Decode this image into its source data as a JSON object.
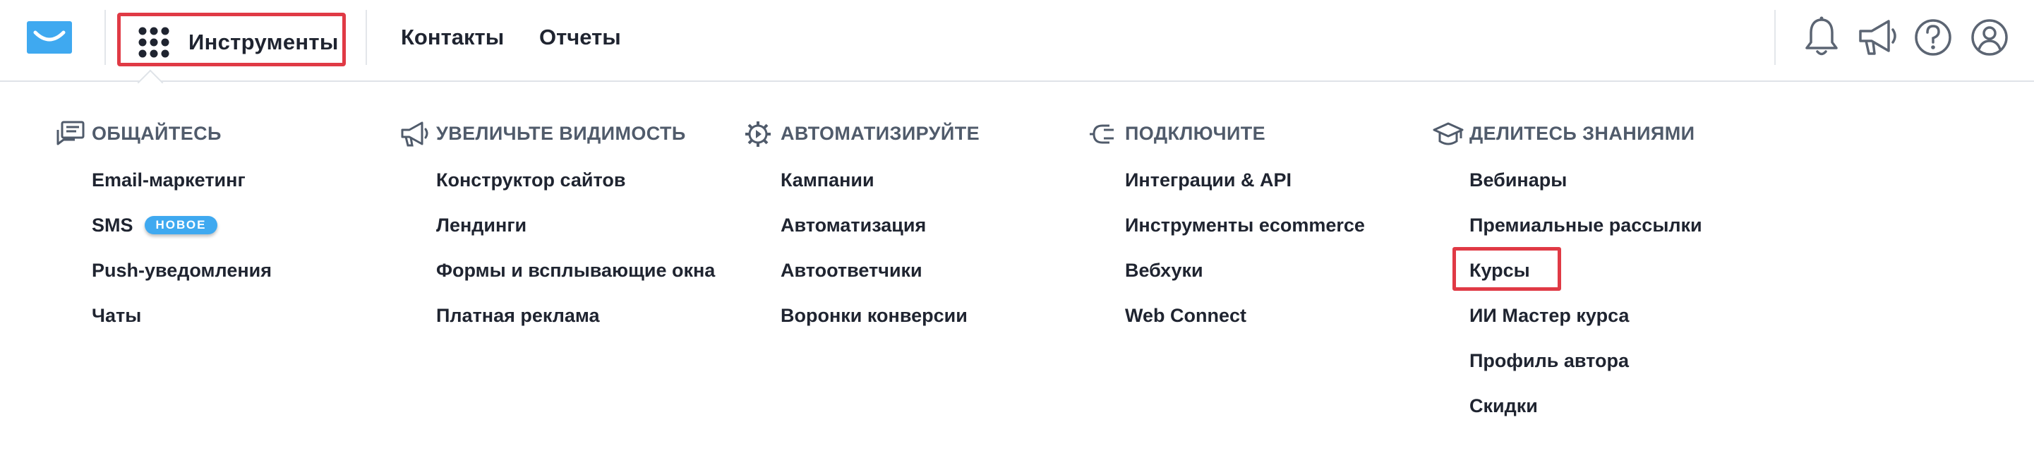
{
  "header": {
    "tools_label": "Инструменты",
    "nav": [
      "Контакты",
      "Отчеты"
    ],
    "icons": [
      "bell-icon",
      "megaphone-icon",
      "help-icon",
      "account-icon"
    ]
  },
  "menu": {
    "columns": [
      {
        "icon": "chat-icon",
        "title": "ОБЩАЙТЕСЬ",
        "items": [
          {
            "label": "Email-маркетинг"
          },
          {
            "label": "SMS",
            "badge": "НОВОЕ"
          },
          {
            "label": "Push-уведомления"
          },
          {
            "label": "Чаты"
          }
        ]
      },
      {
        "icon": "megaphone-icon",
        "title": "УВЕЛИЧЬТЕ ВИДИМОСТЬ",
        "items": [
          {
            "label": "Конструктор сайтов"
          },
          {
            "label": "Лендинги"
          },
          {
            "label": "Формы и всплывающие окна"
          },
          {
            "label": "Платная реклама"
          }
        ]
      },
      {
        "icon": "gear-icon",
        "title": "АВТОМАТИЗИРУЙТЕ",
        "items": [
          {
            "label": "Кампании"
          },
          {
            "label": "Автоматизация"
          },
          {
            "label": "Автоответчики"
          },
          {
            "label": "Воронки конверсии"
          }
        ]
      },
      {
        "icon": "plug-icon",
        "title": "ПОДКЛЮЧИТЕ",
        "items": [
          {
            "label": "Интеграции & API"
          },
          {
            "label": "Инструменты ecommerce"
          },
          {
            "label": "Вебхуки"
          },
          {
            "label": "Web Connect"
          }
        ]
      },
      {
        "icon": "graduation-cap-icon",
        "title": "ДЕЛИТЕСЬ ЗНАНИЯМИ",
        "items": [
          {
            "label": "Вебинары"
          },
          {
            "label": "Премиальные рассылки"
          },
          {
            "label": "Курсы"
          },
          {
            "label": "ИИ Мастер курса"
          },
          {
            "label": "Профиль автора"
          },
          {
            "label": "Скидки"
          }
        ]
      }
    ]
  },
  "colors": {
    "accent": "#3fa9f0",
    "highlight": "#e03a45",
    "text": "#1f2430",
    "muted": "#505b6b"
  }
}
